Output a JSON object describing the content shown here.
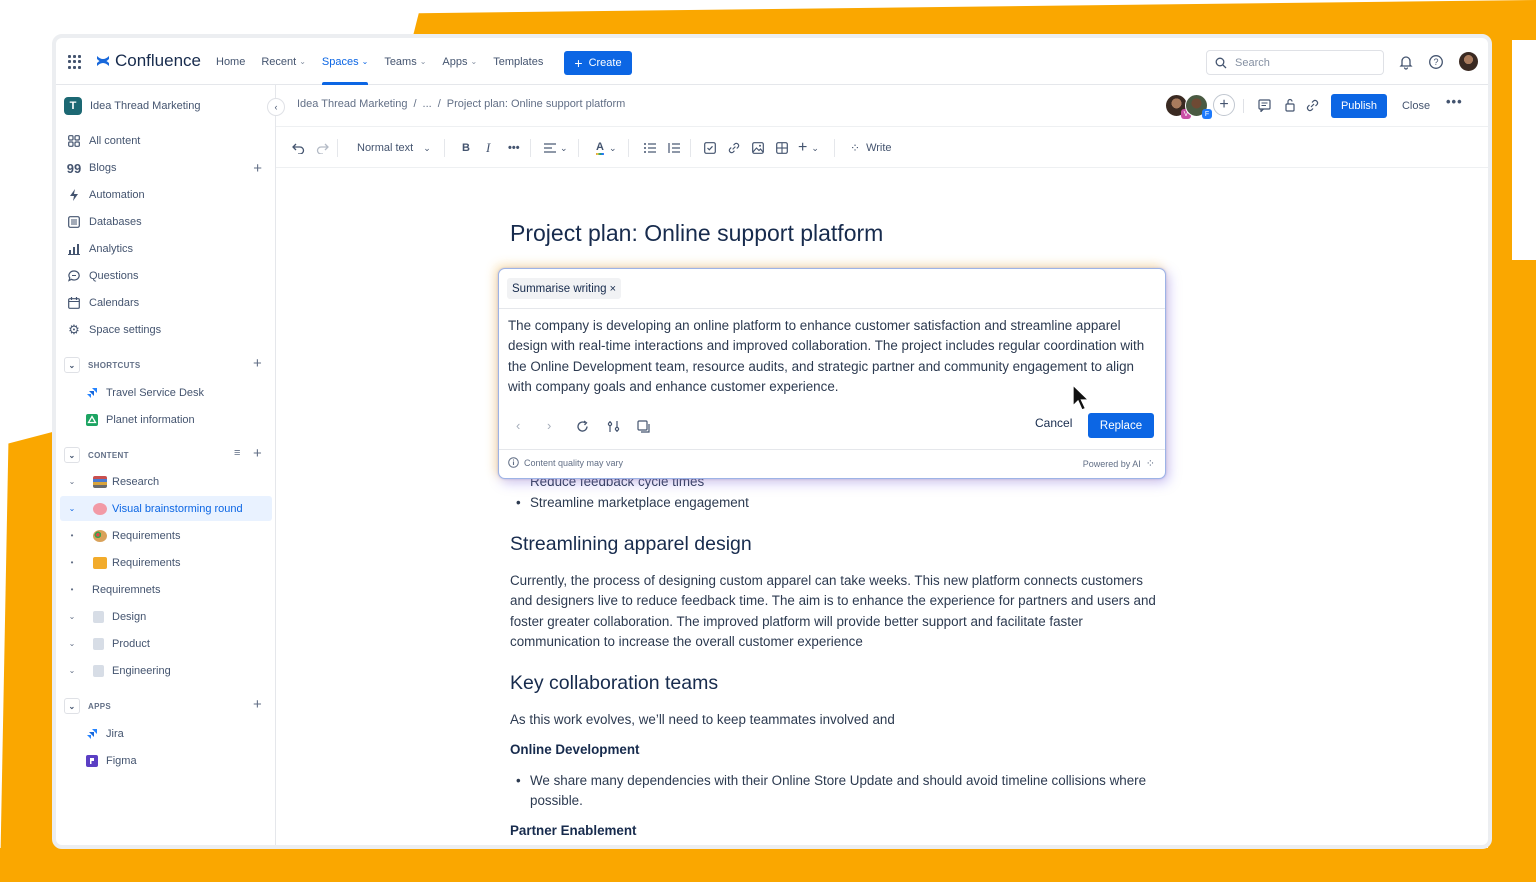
{
  "app": {
    "name": "Confluence",
    "accent_color": "#0C66E4",
    "background_accent": "#FAA700"
  },
  "topnav": {
    "items": [
      {
        "label": "Home",
        "has_dropdown": false,
        "active": false
      },
      {
        "label": "Recent",
        "has_dropdown": true,
        "active": false
      },
      {
        "label": "Spaces",
        "has_dropdown": true,
        "active": true
      },
      {
        "label": "Teams",
        "has_dropdown": true,
        "active": false
      },
      {
        "label": "Apps",
        "has_dropdown": true,
        "active": false
      },
      {
        "label": "Templates",
        "has_dropdown": false,
        "active": false
      }
    ],
    "create_label": "Create",
    "search_placeholder": "Search",
    "icons": [
      "app-switcher-icon",
      "notifications-bell-icon",
      "help-icon",
      "profile-avatar"
    ]
  },
  "sidebar": {
    "space_name": "Idea Thread Marketing",
    "items": [
      {
        "label": "All content",
        "icon": "all-content-icon"
      },
      {
        "label": "Blogs",
        "icon": "quote-icon",
        "has_add": true
      },
      {
        "label": "Automation",
        "icon": "lightning-icon"
      },
      {
        "label": "Databases",
        "icon": "database-icon"
      },
      {
        "label": "Analytics",
        "icon": "chart-icon"
      },
      {
        "label": "Questions",
        "icon": "speech-bubble-icon"
      },
      {
        "label": "Calendars",
        "icon": "calendar-icon"
      },
      {
        "label": "Space settings",
        "icon": "gear-icon"
      }
    ],
    "shortcuts": {
      "label": "SHORTCUTS",
      "items": [
        {
          "label": "Travel Service Desk",
          "icon": "jira-icon"
        },
        {
          "label": "Planet information",
          "icon": "google-drive-icon"
        }
      ]
    },
    "content": {
      "label": "CONTENT",
      "items": [
        {
          "label": "Research",
          "toggle": "chevron",
          "emoji": "books"
        },
        {
          "label": "Visual brainstorming round",
          "toggle": "chevron",
          "emoji": "brain",
          "selected": true
        },
        {
          "label": "Requirements",
          "toggle": "bullet",
          "emoji": "palette"
        },
        {
          "label": "Requirements",
          "toggle": "bullet",
          "emoji": "notebook"
        },
        {
          "label": "Requiremnets",
          "toggle": "bullet",
          "emoji": ""
        },
        {
          "label": "Design",
          "toggle": "chevron",
          "emoji": "page"
        },
        {
          "label": "Product",
          "toggle": "chevron",
          "emoji": "page"
        },
        {
          "label": "Engineering",
          "toggle": "chevron",
          "emoji": "page"
        }
      ]
    },
    "apps": {
      "label": "APPS",
      "items": [
        {
          "label": "Jira",
          "icon": "jira-icon"
        },
        {
          "label": "Figma",
          "icon": "figma-icon"
        }
      ]
    }
  },
  "breadcrumb": [
    "Idea Thread Marketing",
    "...",
    "Project plan: Online support platform"
  ],
  "page_actions": {
    "collaborator_badges": [
      "V",
      "F"
    ],
    "publish_label": "Publish",
    "close_label": "Close"
  },
  "toolbar": {
    "text_style": "Normal text",
    "write_label": "Write"
  },
  "document": {
    "title": "Project plan: Online support platform",
    "partially_hidden_bullet": "Reduce feedback cycle times",
    "bullet_1": "Streamline marketplace engagement",
    "section_1_heading": "Streamlining apparel design",
    "section_1_body": "Currently, the process of designing custom apparel can take weeks. This new platform connects customers and designers live to reduce feedback time. The aim is to enhance the experience for partners and users and foster greater collaboration. The improved platform will provide better support and facilitate faster communication to increase the overall customer experience",
    "section_2_heading": "Key collaboration teams",
    "section_2_intro": "As this work evolves, we’ll need to keep teammates involved and",
    "team_1_heading": "Online Development",
    "team_1_bullet": "We share many dependencies with their Online Store Update and should avoid timeline collisions where possible.",
    "team_2_heading": "Partner Enablement"
  },
  "ai_panel": {
    "chip_label": "Summarise writing",
    "summary": "The company is developing an online platform to enhance customer satisfaction and streamline apparel design with real-time interactions and improved collaboration. The project includes regular coordination with the Online Development team, resource audits, and strategic partner and community engagement to align with company goals and enhance customer experience.",
    "cancel_label": "Cancel",
    "replace_label": "Replace",
    "disclaimer": "Content quality may vary",
    "powered_by": "Powered by AI"
  }
}
